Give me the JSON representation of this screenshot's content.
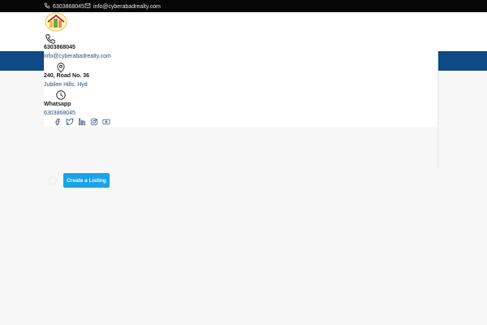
{
  "topbar": {
    "phone": "6303868045",
    "email": "info@cyberabadrealty.com",
    "icons": {
      "phone": "phone-icon",
      "email": "envelope-icon"
    }
  },
  "logo": {
    "alt_text": "CYBERABAD REALTY",
    "icon": "logo-house-icon"
  },
  "contact": [
    {
      "icon": "phone-icon",
      "title": "6303868045",
      "value": "info@cyberabadrealty.com"
    },
    {
      "icon": "map-pin-icon",
      "title": "240, Road No. 36",
      "value": "Jubilee Hills, Hyd"
    },
    {
      "icon": "clock-icon",
      "title": "Whatsapp",
      "value": "6303868045"
    }
  ],
  "social_icons": [
    "facebook-icon",
    "twitter-icon",
    "linkedin-icon",
    "instagram-icon",
    "youtube-icon"
  ],
  "cta": {
    "label": "Create a Listing"
  },
  "colors": {
    "topbar": "#070707",
    "nav": "#0d4a86",
    "cta": "#1aa3ea",
    "bg": "#f7f7f7"
  }
}
